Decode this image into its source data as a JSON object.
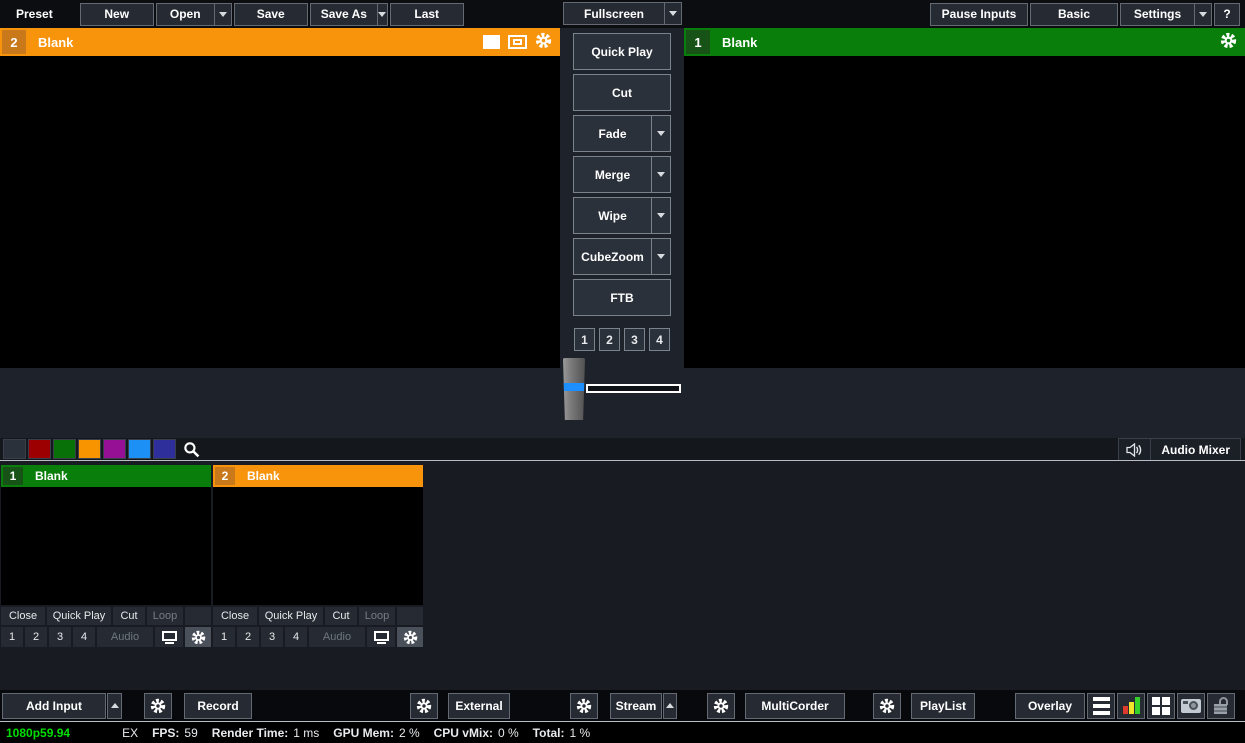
{
  "topbar": {
    "preset_label": "Preset",
    "new": "New",
    "open": "Open",
    "save": "Save",
    "save_as": "Save As",
    "last": "Last",
    "fullscreen": "Fullscreen",
    "pause_inputs": "Pause Inputs",
    "basic": "Basic",
    "settings": "Settings",
    "help": "?"
  },
  "preview_left": {
    "number": "2",
    "title": "Blank"
  },
  "preview_right": {
    "number": "1",
    "title": "Blank"
  },
  "transitions": [
    {
      "label": "Quick Play"
    },
    {
      "label": "Cut"
    },
    {
      "label": "Fade"
    },
    {
      "label": "Merge"
    },
    {
      "label": "Wipe"
    },
    {
      "label": "CubeZoom"
    },
    {
      "label": "FTB"
    }
  ],
  "transition_numbers": [
    "1",
    "2",
    "3",
    "4"
  ],
  "tabs_row": {
    "audio_mixer_label": "Audio Mixer",
    "swatch_colors": [
      "#2B313A",
      "#9C0000",
      "#087208",
      "#F79400",
      "#951095",
      "#1D90F5",
      "#2F2F9C"
    ]
  },
  "inputs": [
    {
      "number": "1",
      "title": "Blank",
      "close": "Close",
      "quick_play": "Quick Play",
      "cut": "Cut",
      "loop": "Loop",
      "n1": "1",
      "n2": "2",
      "n3": "3",
      "n4": "4",
      "audio": "Audio"
    },
    {
      "number": "2",
      "title": "Blank",
      "close": "Close",
      "quick_play": "Quick Play",
      "cut": "Cut",
      "loop": "Loop",
      "n1": "1",
      "n2": "2",
      "n3": "3",
      "n4": "4",
      "audio": "Audio"
    }
  ],
  "bottom": {
    "add_input": "Add Input",
    "record": "Record",
    "external": "External",
    "stream": "Stream",
    "multicorder": "MultiCorder",
    "playlist": "PlayList",
    "overlay": "Overlay"
  },
  "status": {
    "resolution": "1080p59.94",
    "ex": "EX",
    "fps_label": "FPS:",
    "fps_value": "59",
    "render_label": "Render Time:",
    "render_value": "1 ms",
    "gpu_label": "GPU Mem:",
    "gpu_value": "2 %",
    "cpu_label": "CPU vMix:",
    "cpu_value": "0 %",
    "total_label": "Total:",
    "total_value": "1 %"
  },
  "colors": {
    "preview_orange": "#F7940C",
    "program_green": "#0A7E0A",
    "tbar_blue": "#1D8FFF",
    "status_green": "#00DD00",
    "button_bg": "#262B33",
    "button_border": "#636A73"
  }
}
